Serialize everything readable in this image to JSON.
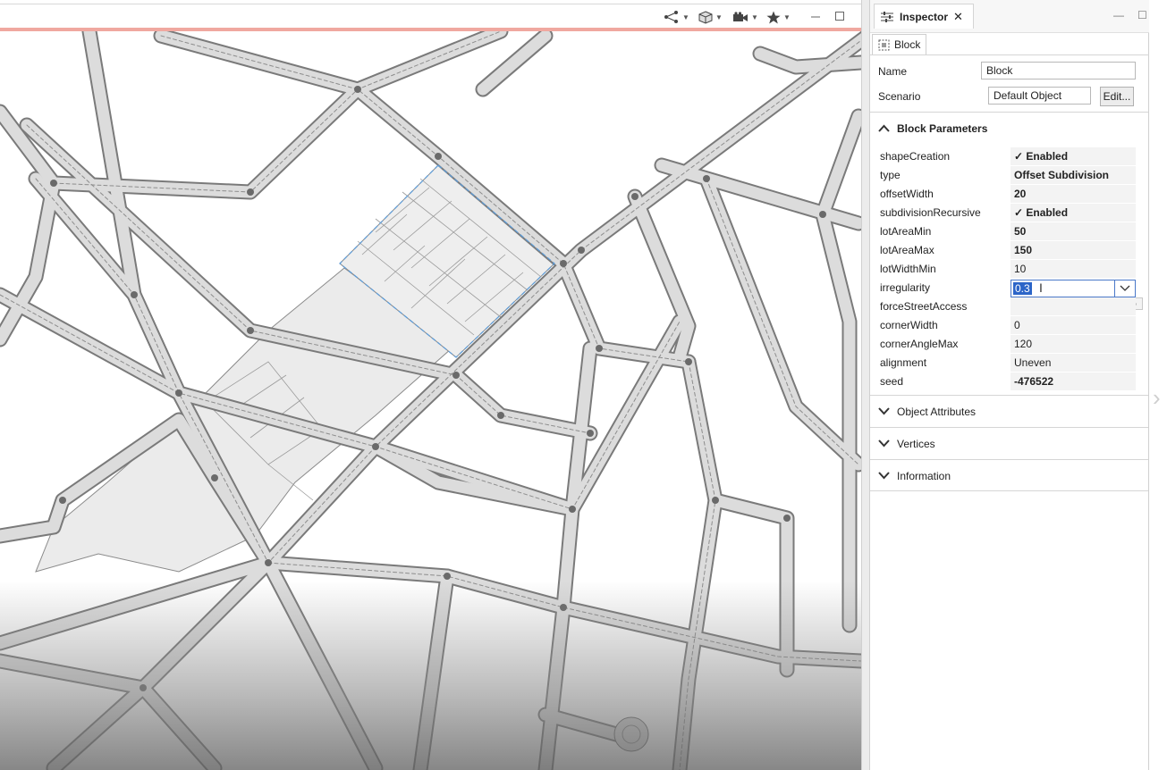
{
  "viewport": {
    "toolbar_icons": [
      "graph-icon",
      "cube-icon",
      "camera-icon",
      "star-icon",
      "minimize-icon",
      "maximize-icon"
    ]
  },
  "inspector": {
    "tab_title": "Inspector",
    "close_glyph": "✕",
    "minimize_glyph": "—",
    "maximize_glyph": "☐",
    "object_tab": "Block",
    "name_label": "Name",
    "name_value": "Block",
    "scenario_label": "Scenario",
    "scenario_value": "Default Object",
    "edit_label": "Edit...",
    "sections": {
      "block_parameters": "Block Parameters",
      "object_attributes": "Object Attributes",
      "vertices": "Vertices",
      "information": "Information"
    },
    "params": [
      {
        "name": "shapeCreation",
        "value": "✓ Enabled",
        "bold": true
      },
      {
        "name": "type",
        "value": "Offset Subdivision",
        "bold": true
      },
      {
        "name": "offsetWidth",
        "value": "20",
        "bold": true
      },
      {
        "name": "subdivisionRecursive",
        "value": "✓ Enabled",
        "bold": true
      },
      {
        "name": "lotAreaMin",
        "value": "50",
        "bold": true
      },
      {
        "name": "lotAreaMax",
        "value": "150",
        "bold": true
      },
      {
        "name": "lotWidthMin",
        "value": "10",
        "bold": false
      },
      {
        "name": "irregularity",
        "value": "0.3",
        "bold": false
      },
      {
        "name": "forceStreetAccess",
        "value": "",
        "bold": false
      },
      {
        "name": "cornerWidth",
        "value": "0",
        "bold": false
      },
      {
        "name": "cornerAngleMax",
        "value": "120",
        "bold": false
      },
      {
        "name": "alignment",
        "value": "Uneven",
        "bold": false
      },
      {
        "name": "seed",
        "value": "-476522",
        "bold": true
      }
    ],
    "irregularity_slider": 0.3,
    "accent_color": "#2c65c8"
  }
}
